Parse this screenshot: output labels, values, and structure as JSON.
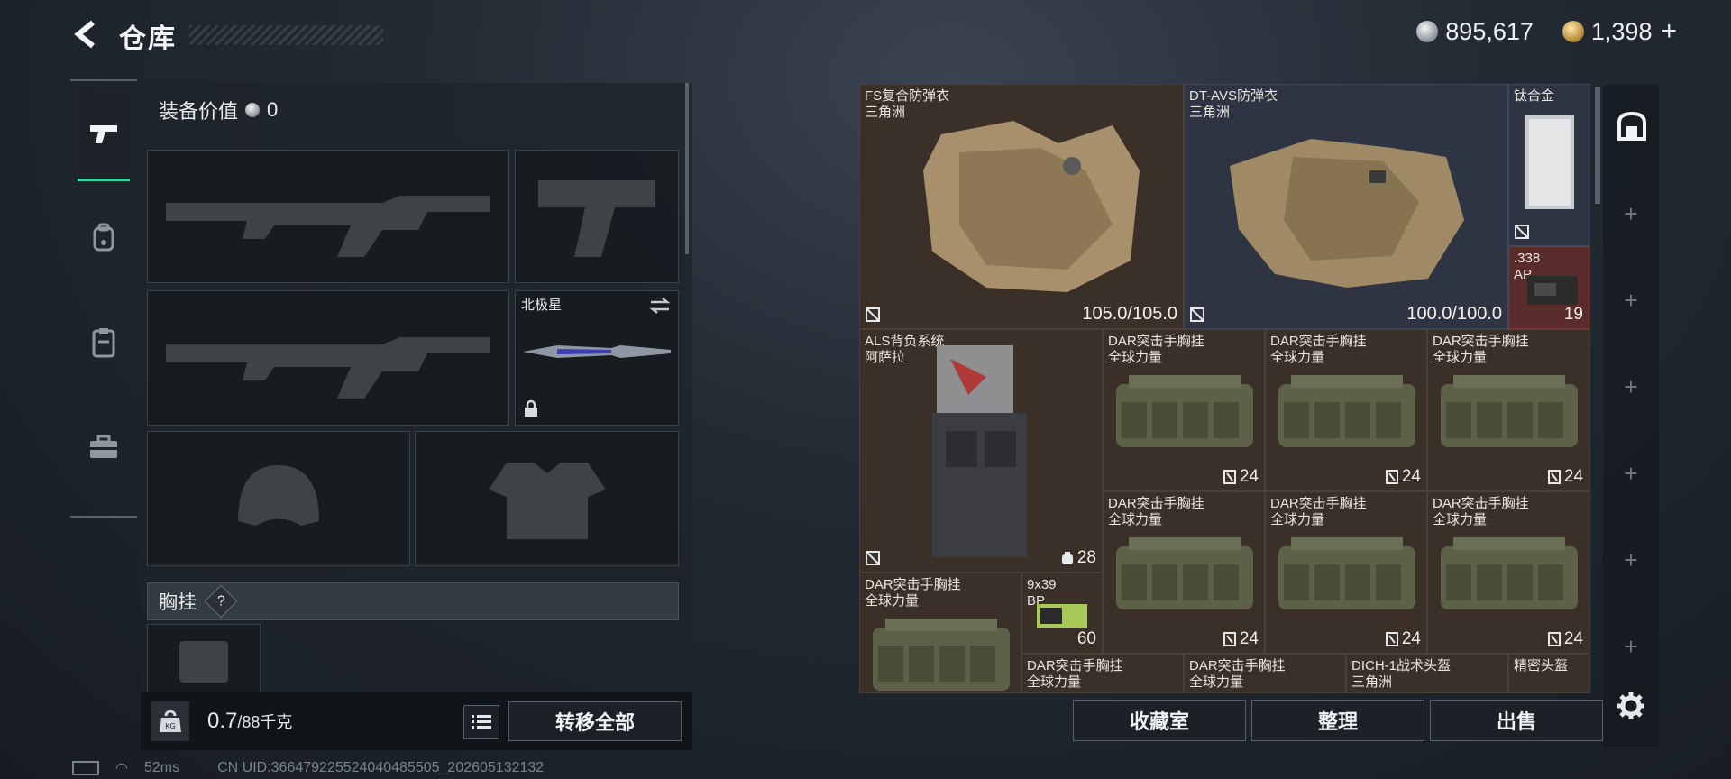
{
  "header": {
    "title": "仓库"
  },
  "currency": {
    "silver": "895,617",
    "gold": "1,398",
    "add": "+"
  },
  "equip_value": {
    "label": "装备价值",
    "value": "0"
  },
  "slots": {
    "melee_name": "北极星"
  },
  "chest_section": {
    "label": "胸挂",
    "help": "?"
  },
  "footer_left": {
    "weight_current": "0.7",
    "weight_max": "/88千克",
    "transfer_all": "转移全部"
  },
  "grid": {
    "items": [
      {
        "name": "FS复合防弹衣",
        "sub": "三角洲",
        "durability": "105.0/105.0"
      },
      {
        "name": "DT-AVS防弹衣",
        "sub": "三角洲",
        "durability": "100.0/100.0"
      },
      {
        "name": "钛合金"
      },
      {
        "name": ".338",
        "sub": "AP",
        "qty": "19"
      },
      {
        "name": "ALS背负系统",
        "sub": "阿萨拉",
        "qty": "28"
      },
      {
        "name": "DAR突击手胸挂",
        "sub": "全球力量",
        "qty": "24"
      },
      {
        "name": "DAR突击手胸挂",
        "sub": "全球力量",
        "qty": "24"
      },
      {
        "name": "DAR突击手胸挂",
        "sub": "全球力量",
        "qty": "24"
      },
      {
        "name": "DAR突击手胸挂",
        "sub": "全球力量",
        "qty": "24"
      },
      {
        "name": "DAR突击手胸挂",
        "sub": "全球力量",
        "qty": "24"
      },
      {
        "name": "DAR突击手胸挂",
        "sub": "全球力量",
        "qty": "24"
      },
      {
        "name": "DAR突击手胸挂",
        "sub": "全球力量"
      },
      {
        "name": "9x39",
        "sub": "BP",
        "qty": "60"
      },
      {
        "name": "DAR突击手胸挂",
        "sub": "全球力量"
      },
      {
        "name": "DAR突击手胸挂",
        "sub": "全球力量"
      },
      {
        "name": "DICH-1战术头盔",
        "sub": "三角洲"
      },
      {
        "name": "精密头盔"
      }
    ]
  },
  "footer_right": {
    "collection": "收藏室",
    "organize": "整理",
    "sell": "出售"
  },
  "status": {
    "ping": "52ms",
    "uid": "CN UID:366479225524040485505_202605132132"
  },
  "colors": {
    "accent": "#3fd1a4",
    "cell_brown": "#3a3028",
    "cell_blue": "#2e3442",
    "cell_red": "#5a2b2b"
  }
}
